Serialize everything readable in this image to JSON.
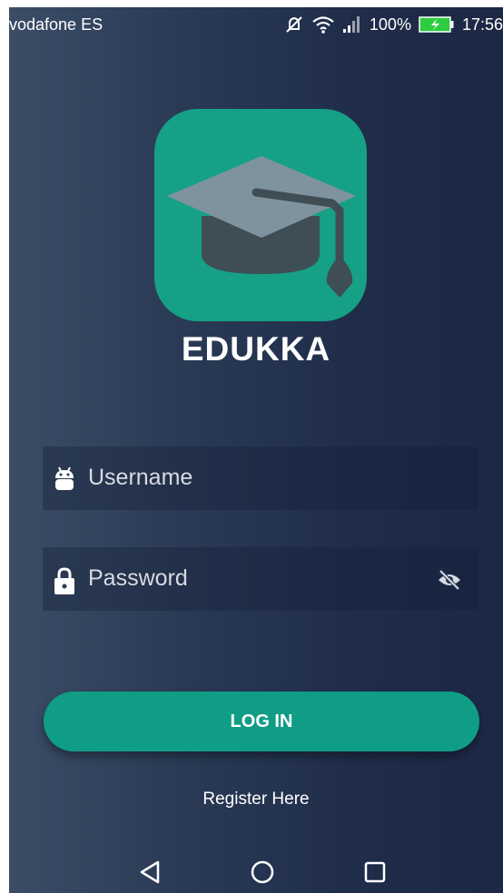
{
  "status_bar": {
    "carrier": "vodafone ES",
    "battery_percent": "100%",
    "time": "17:56",
    "icons": [
      "mute-icon",
      "wifi-icon",
      "signal-icon",
      "battery-charging-icon"
    ]
  },
  "logo": {
    "icon": "graduation-cap-icon",
    "app_name": "EDUKKA"
  },
  "login_form": {
    "username": {
      "icon": "android-icon",
      "placeholder": "Username"
    },
    "password": {
      "icon": "lock-icon",
      "placeholder": "Password",
      "toggle_icon": "eye-off-icon"
    },
    "login_button": "LOG IN",
    "register_link": "Register Here"
  },
  "nav_bar": {
    "icons": [
      "back-icon",
      "home-icon",
      "recents-icon"
    ]
  },
  "colors": {
    "accent": "#16a085",
    "button": "#0f9d86",
    "background_dark": "#1c2845",
    "background_light": "#3b4d66",
    "cap_light": "#7f939e",
    "cap_dark": "#3f4d55"
  }
}
